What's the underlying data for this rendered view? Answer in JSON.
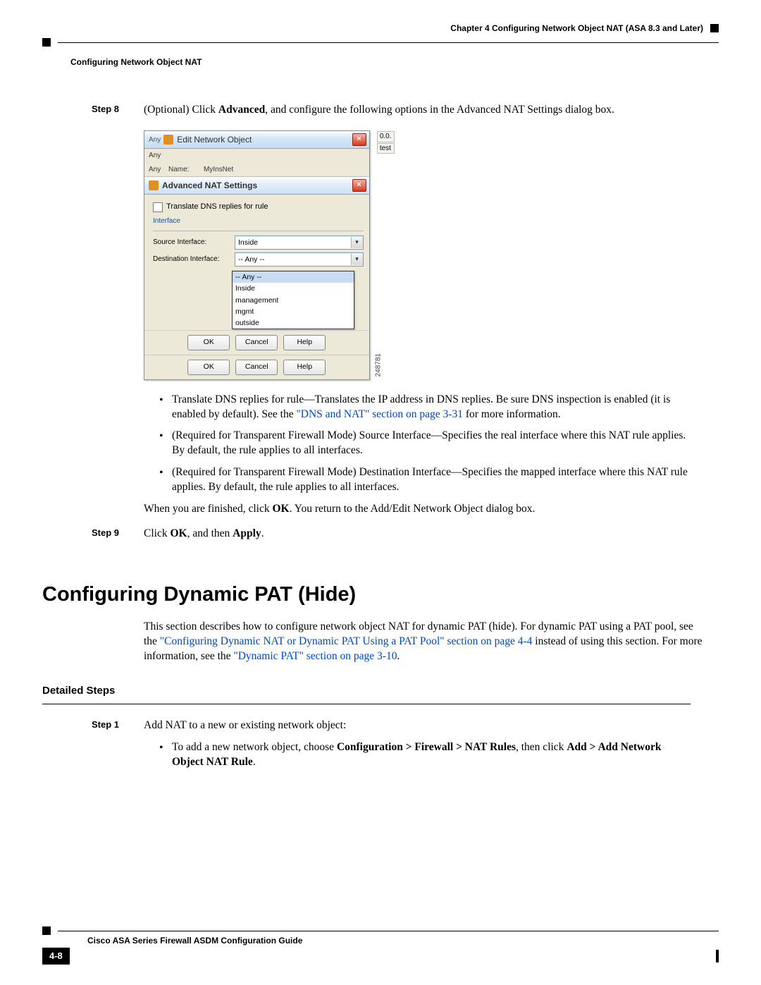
{
  "header": {
    "chapter": "Chapter 4      Configuring Network Object NAT (ASA 8.3 and Later)",
    "section": "Configuring Network Object NAT"
  },
  "step8": {
    "label": "Step 8",
    "text_a": "(Optional) Click ",
    "text_b": "Advanced",
    "text_c": ", and configure the following options in the Advanced NAT Settings dialog box."
  },
  "dialog": {
    "edit_title": "Edit Network Object",
    "name_label": "Name:",
    "name_value": "MyInsNet",
    "adv_title": "Advanced NAT Settings",
    "chk_label": "Translate DNS replies for rule",
    "fieldset": "Interface",
    "src_label": "Source Interface:",
    "src_value": "Inside",
    "dst_label": "Destination Interface:",
    "dst_value": "-- Any --",
    "options": [
      "-- Any --",
      "Inside",
      "management",
      "mgmt",
      "outside"
    ],
    "btn_ok": "OK",
    "btn_cancel": "Cancel",
    "btn_help": "Help",
    "bg_any": "Any",
    "side_top": "0.0.",
    "side_mid": "test",
    "image_id": "248781"
  },
  "bullets": {
    "b1_a": "Translate DNS replies for rule—Translates the IP address in DNS replies. Be sure DNS inspection is enabled (it is enabled by default). See the ",
    "b1_link": "\"DNS and NAT\" section on page 3-31",
    "b1_b": " for more information.",
    "b2": "(Required for Transparent Firewall Mode) Source Interface—Specifies the real interface where this NAT rule applies. By default, the rule applies to all interfaces.",
    "b3": "(Required for Transparent Firewall Mode) Destination Interface—Specifies the mapped interface where this NAT rule applies. By default, the rule applies to all interfaces."
  },
  "finish": {
    "a": "When you are finished, click ",
    "b": "OK",
    "c": ". You return to the Add/Edit Network Object dialog box."
  },
  "step9": {
    "label": "Step 9",
    "a": "Click ",
    "b": "OK",
    "c": ", and then ",
    "d": "Apply",
    "e": "."
  },
  "heading": "Configuring Dynamic PAT (Hide)",
  "intro": {
    "a": "This section describes how to configure network object NAT for dynamic PAT (hide). For dynamic PAT using a PAT pool, see the ",
    "link1": "\"Configuring Dynamic NAT or Dynamic PAT Using a PAT Pool\" section on page 4-4",
    "b": " instead of using this section. For more information, see the ",
    "link2": "\"Dynamic PAT\" section on page 3-10",
    "c": "."
  },
  "detailed_heading": "Detailed Steps",
  "step1": {
    "label": "Step 1",
    "text": "Add NAT to a new or existing network object:",
    "bullet_a": "To add a new network object, choose ",
    "bullet_b": "Configuration > Firewall > NAT Rules",
    "bullet_c": ", then click ",
    "bullet_d": "Add > Add Network Object NAT Rule",
    "bullet_e": "."
  },
  "footer": {
    "title": "Cisco ASA Series Firewall ASDM Configuration Guide",
    "page": "4-8"
  }
}
